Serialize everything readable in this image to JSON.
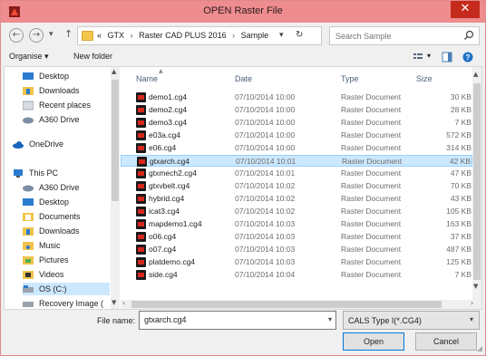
{
  "window": {
    "title": "OPEN Raster File",
    "close_glyph": "✕",
    "accent_color": "#ee8c8f",
    "close_color": "#c42b1c"
  },
  "address": {
    "back_glyph": "←",
    "forward_glyph": "→",
    "recent_glyph": "▾",
    "up_glyph": "↑",
    "overflow": "«",
    "crumbs": [
      "GTX",
      "Raster CAD PLUS 2016",
      "Sample"
    ],
    "crumb_sep": "›",
    "dropdown_glyph": "▾",
    "refresh_glyph": "↻",
    "search_placeholder": "Search Sample"
  },
  "toolbar": {
    "organise_label": "Organise ▾",
    "new_folder_label": "New folder",
    "view_menu_glyph": "▾",
    "icons": [
      "view-icon",
      "preview-pane-icon",
      "help-icon"
    ]
  },
  "nav": {
    "items": [
      {
        "label": "Desktop",
        "icon": "desktop-icon",
        "child": true
      },
      {
        "label": "Downloads",
        "icon": "downloads-icon",
        "child": true
      },
      {
        "label": "Recent places",
        "icon": "recent-places-icon",
        "child": true
      },
      {
        "label": "A360 Drive",
        "icon": "a360-drive-icon",
        "child": true
      },
      {
        "label": "OneDrive",
        "icon": "onedrive-icon",
        "child": false
      },
      {
        "label": "This PC",
        "icon": "this-pc-icon",
        "child": false
      },
      {
        "label": "A360 Drive",
        "icon": "a360-drive-icon",
        "child": true
      },
      {
        "label": "Desktop",
        "icon": "desktop-icon",
        "child": true
      },
      {
        "label": "Documents",
        "icon": "documents-icon",
        "child": true
      },
      {
        "label": "Downloads",
        "icon": "downloads-icon",
        "child": true
      },
      {
        "label": "Music",
        "icon": "music-icon",
        "child": true
      },
      {
        "label": "Pictures",
        "icon": "pictures-icon",
        "child": true
      },
      {
        "label": "Videos",
        "icon": "videos-icon",
        "child": true
      },
      {
        "label": "OS (C:)",
        "icon": "drive-icon",
        "child": true,
        "selected": true
      },
      {
        "label": "Recovery Image (",
        "icon": "drive-icon",
        "child": true
      }
    ]
  },
  "files": {
    "columns": {
      "name": "Name",
      "date": "Date",
      "type": "Type",
      "size": "Size"
    },
    "rows": [
      {
        "name": "demo1.cg4",
        "date": "07/10/2014 10:00",
        "type": "Raster Document",
        "size": "30 KB"
      },
      {
        "name": "demo2.cg4",
        "date": "07/10/2014 10:00",
        "type": "Raster Document",
        "size": "28 KB"
      },
      {
        "name": "demo3.cg4",
        "date": "07/10/2014 10:00",
        "type": "Raster Document",
        "size": "7 KB"
      },
      {
        "name": "e03a.cg4",
        "date": "07/10/2014 10:00",
        "type": "Raster Document",
        "size": "572 KB"
      },
      {
        "name": "e06.cg4",
        "date": "07/10/2014 10:00",
        "type": "Raster Document",
        "size": "314 KB"
      },
      {
        "name": "gtxarch.cg4",
        "date": "07/10/2014 10:01",
        "type": "Raster Document",
        "size": "42 KB",
        "selected": true
      },
      {
        "name": "gtxmech2.cg4",
        "date": "07/10/2014 10:01",
        "type": "Raster Document",
        "size": "47 KB"
      },
      {
        "name": "gtxvbelt.cg4",
        "date": "07/10/2014 10:02",
        "type": "Raster Document",
        "size": "70 KB"
      },
      {
        "name": "hybrid.cg4",
        "date": "07/10/2014 10:02",
        "type": "Raster Document",
        "size": "43 KB"
      },
      {
        "name": "icat3.cg4",
        "date": "07/10/2014 10:02",
        "type": "Raster Document",
        "size": "105 KB"
      },
      {
        "name": "mapdemo1.cg4",
        "date": "07/10/2014 10:03",
        "type": "Raster Document",
        "size": "163 KB"
      },
      {
        "name": "o06.cg4",
        "date": "07/10/2014 10:03",
        "type": "Raster Document",
        "size": "37 KB"
      },
      {
        "name": "o07.cg4",
        "date": "07/10/2014 10:03",
        "type": "Raster Document",
        "size": "487 KB"
      },
      {
        "name": "platdemo.cg4",
        "date": "07/10/2014 10:03",
        "type": "Raster Document",
        "size": "125 KB"
      },
      {
        "name": "side.cg4",
        "date": "07/10/2014 10:04",
        "type": "Raster Document",
        "size": "7 KB"
      }
    ]
  },
  "footer": {
    "file_name_label": "File name:",
    "file_name_value": "gtxarch.cg4",
    "file_type_value": "CALS Type I(*.CG4)",
    "open_label": "Open",
    "cancel_label": "Cancel",
    "dropdown_glyph": "▾"
  }
}
